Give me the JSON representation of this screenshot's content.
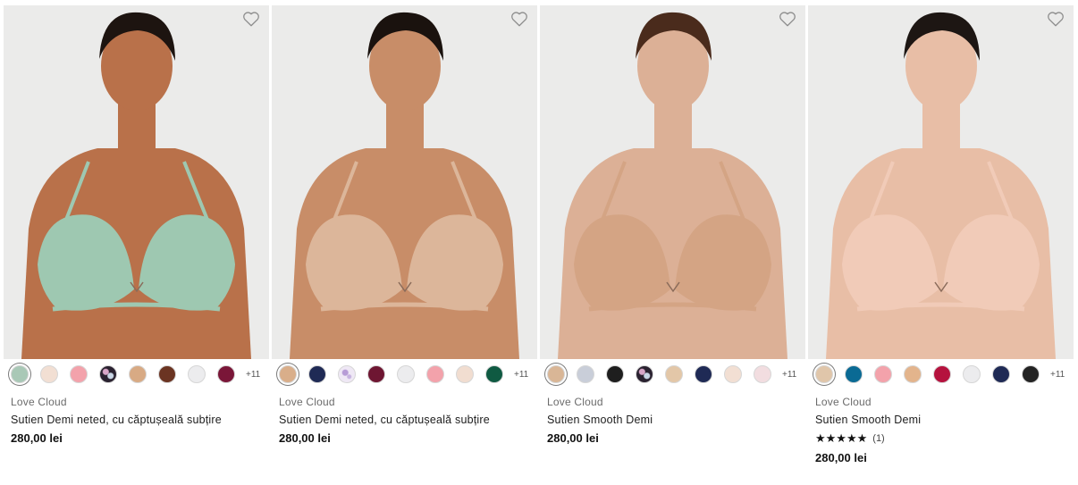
{
  "products": [
    {
      "brand": "Love Cloud",
      "name": "Sutien Demi neted, cu căptușeală subțire",
      "price": "280,00 lei",
      "more_colors": "+11",
      "swatches": [
        "#a9c8b6",
        "#f2dfd3",
        "#f3a2ab",
        "floral",
        "#d8aa84",
        "#6b3422",
        "#ececee",
        "#7a1638"
      ],
      "bra_color": "#9ec8b1",
      "skin": "#b9714a",
      "hair": "#1d1410"
    },
    {
      "brand": "Love Cloud",
      "name": "Sutien Demi neted, cu căptușeală subțire",
      "price": "280,00 lei",
      "more_colors": "+11",
      "swatches": [
        "#d9ae8a",
        "#1f2a55",
        "lavender",
        "#6e1632",
        "#ececee",
        "#f3a2ab",
        "#f1ddd0",
        "#0f5a42"
      ],
      "bra_color": "#dcb69a",
      "skin": "#c88d68",
      "hair": "#1a120e"
    },
    {
      "brand": "Love Cloud",
      "name": "Sutien Smooth Demi",
      "price": "280,00 lei",
      "more_colors": "+11",
      "swatches": [
        "#d9b696",
        "#c9ced9",
        "#1e1e1e",
        "floral",
        "#e3c7a8",
        "#1f2a55",
        "#f2dfd3",
        "#f2dde0"
      ],
      "bra_color": "#d4a484",
      "skin": "#dcb096",
      "hair": "#4a2b1c"
    },
    {
      "brand": "Love Cloud",
      "name": "Sutien Smooth Demi",
      "rating_stars": "★★★★★",
      "rating_count": "(1)",
      "price": "280,00 lei",
      "more_colors": "+11",
      "swatches": [
        "#e0c6aa",
        "#0a6a94",
        "#f3a2ab",
        "#e3b48c",
        "#b5123e",
        "#ececee",
        "#1f2a55",
        "#232323"
      ],
      "bra_color": "#f1cbb8",
      "skin": "#e8bea6",
      "hair": "#1d1613"
    }
  ]
}
